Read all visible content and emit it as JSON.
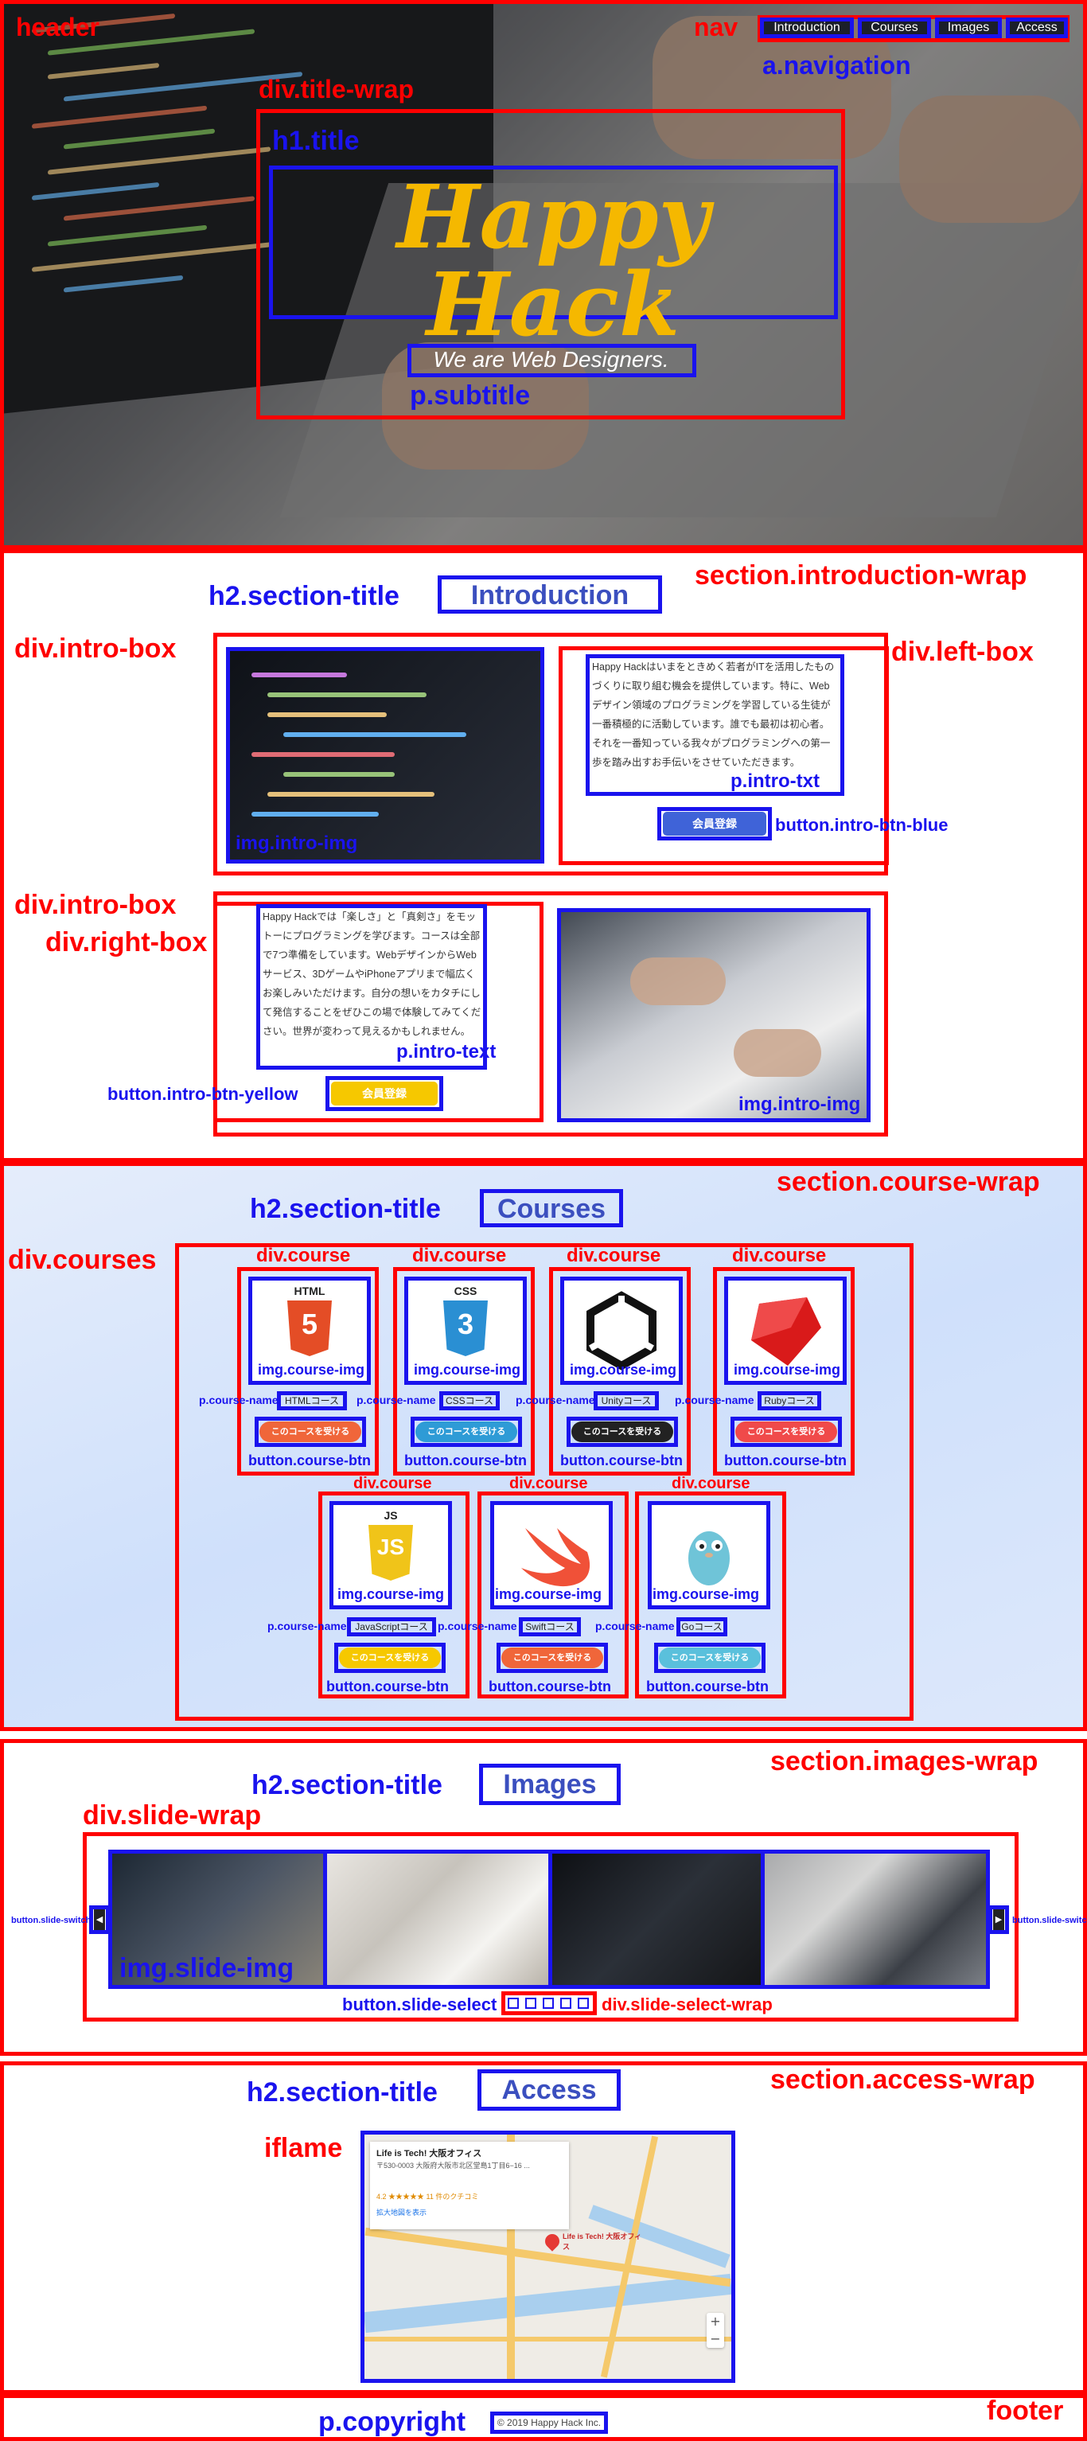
{
  "labels": {
    "header": "header",
    "nav": "nav",
    "navigation": "a.navigation",
    "title_wrap": "div.title-wrap",
    "h1_title": "h1.title",
    "subtitle": "p.subtitle",
    "intro_wrap": "section.introduction-wrap",
    "section_title": "h2.section-title",
    "intro_box": "div.intro-box",
    "left_box": "div.left-box",
    "right_box": "div.right-box",
    "intro_txt": "p.intro-txt",
    "intro_text": "p.intro-text",
    "intro_img": "img.intro-img",
    "intro_btn_blue": "button.intro-btn-blue",
    "intro_btn_yellow": "button.intro-btn-yellow",
    "course_wrap": "section.course-wrap",
    "courses": "div.courses",
    "course": "div.course",
    "course_img": "img.course-img",
    "course_name": "p.course-name",
    "course_btn": "button.course-btn",
    "images_wrap": "section.images-wrap",
    "slide_wrap": "div.slide-wrap",
    "slide_img": "img.slide-img",
    "slide_switch": "button.slide-switch",
    "slide_select": "button.slide-select",
    "slide_select_wrap": "div.slide-select-wrap",
    "access_wrap": "section.access-wrap",
    "iframe": "iflame",
    "footer": "footer",
    "copyright_label": "p.copyright"
  },
  "nav_items": [
    "Introduction",
    "Courses",
    "Images",
    "Access"
  ],
  "hero": {
    "title": "Happy Hack",
    "subtitle": "We are Web Designers."
  },
  "introduction": {
    "title": "Introduction",
    "left_text": "Happy Hackはいまをときめく若者がITを活用したものづくりに取り組む機会を提供しています。特に、Webデザイン領域のプログラミングを学習している生徒が一番積極的に活動しています。誰でも最初は初心者。それを一番知っている我々がプログラミングへの第一歩を踏み出すお手伝いをさせていただきます。",
    "left_button": "会員登録",
    "right_text": "Happy Hackでは「楽しさ」と「真剣さ」をモットーにプログラミングを学びます。コースは全部で7つ準備をしています。WebデザインからWebサービス、3DゲームやiPhoneアプリまで幅広くお楽しみいただけます。自分の想いをカタチにして発信することをぜひこの場で体験してみてください。世界が変わって見えるかもしれません。",
    "right_button": "会員登録"
  },
  "courses": {
    "title": "Courses",
    "button_label": "このコースを受ける",
    "items": [
      {
        "logo": "HTML",
        "name": "HTMLコース",
        "btn_color": "#f0663a"
      },
      {
        "logo": "CSS",
        "name": "CSSコース",
        "btn_color": "#2e9bd6"
      },
      {
        "logo": "",
        "name": "Unityコース",
        "btn_color": "#222222"
      },
      {
        "logo": "",
        "name": "Rubyコース",
        "btn_color": "#f04a4a"
      },
      {
        "logo": "JS",
        "name": "JavaScriptコース",
        "btn_color": "#f6c800"
      },
      {
        "logo": "",
        "name": "Swiftコース",
        "btn_color": "#f0663a"
      },
      {
        "logo": "",
        "name": "Goコース",
        "btn_color": "#5ac0dc"
      }
    ]
  },
  "images": {
    "title": "Images",
    "prev": "◀",
    "next": "▶"
  },
  "access": {
    "title": "Access",
    "map_place": "Life is Tech! 大阪オフィス",
    "map_address": "〒530-0003 大阪府大阪市北区堂島1丁目6−16 ...",
    "map_rating": "4.2 ★★★★★  11 件のクチコミ",
    "map_link": "拡大地図を表示",
    "map_pin": "Life is Tech! 大阪オフィス"
  },
  "footer": {
    "copyright": "© 2019 Happy Hack Inc."
  },
  "colors": {
    "red": "#ff0000",
    "blue": "#1a13ee",
    "title_yellow": "#f5b800",
    "section_title": "#3b4fbf",
    "btn_blue": "#3f63d8",
    "btn_yellow": "#f6c800"
  }
}
